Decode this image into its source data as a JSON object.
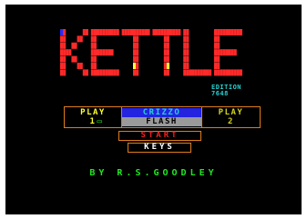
{
  "title": {
    "text": "KETTLE",
    "colors": [
      "#ff2a2a",
      "#ffff33",
      "#22e522",
      "#22d3d3",
      "#2a2aff",
      "#ff33ff",
      "#ffffff",
      "#ff9922"
    ]
  },
  "edition": {
    "line1": "EDITION",
    "line2": "7648"
  },
  "menu": {
    "player1": {
      "top": "PLAY",
      "bottom": "1"
    },
    "mode": {
      "top": "CRIZZO",
      "bottom": "FLASH"
    },
    "player2": {
      "top": "PLAY",
      "bottom": "2"
    },
    "start_label": "START",
    "keys_label": "KEYS"
  },
  "credit": "BY R.S.GOODLEY",
  "colors": {
    "background": "#000000",
    "border": "#e07b1c",
    "credit": "#22e522",
    "start": "#ee2222"
  }
}
